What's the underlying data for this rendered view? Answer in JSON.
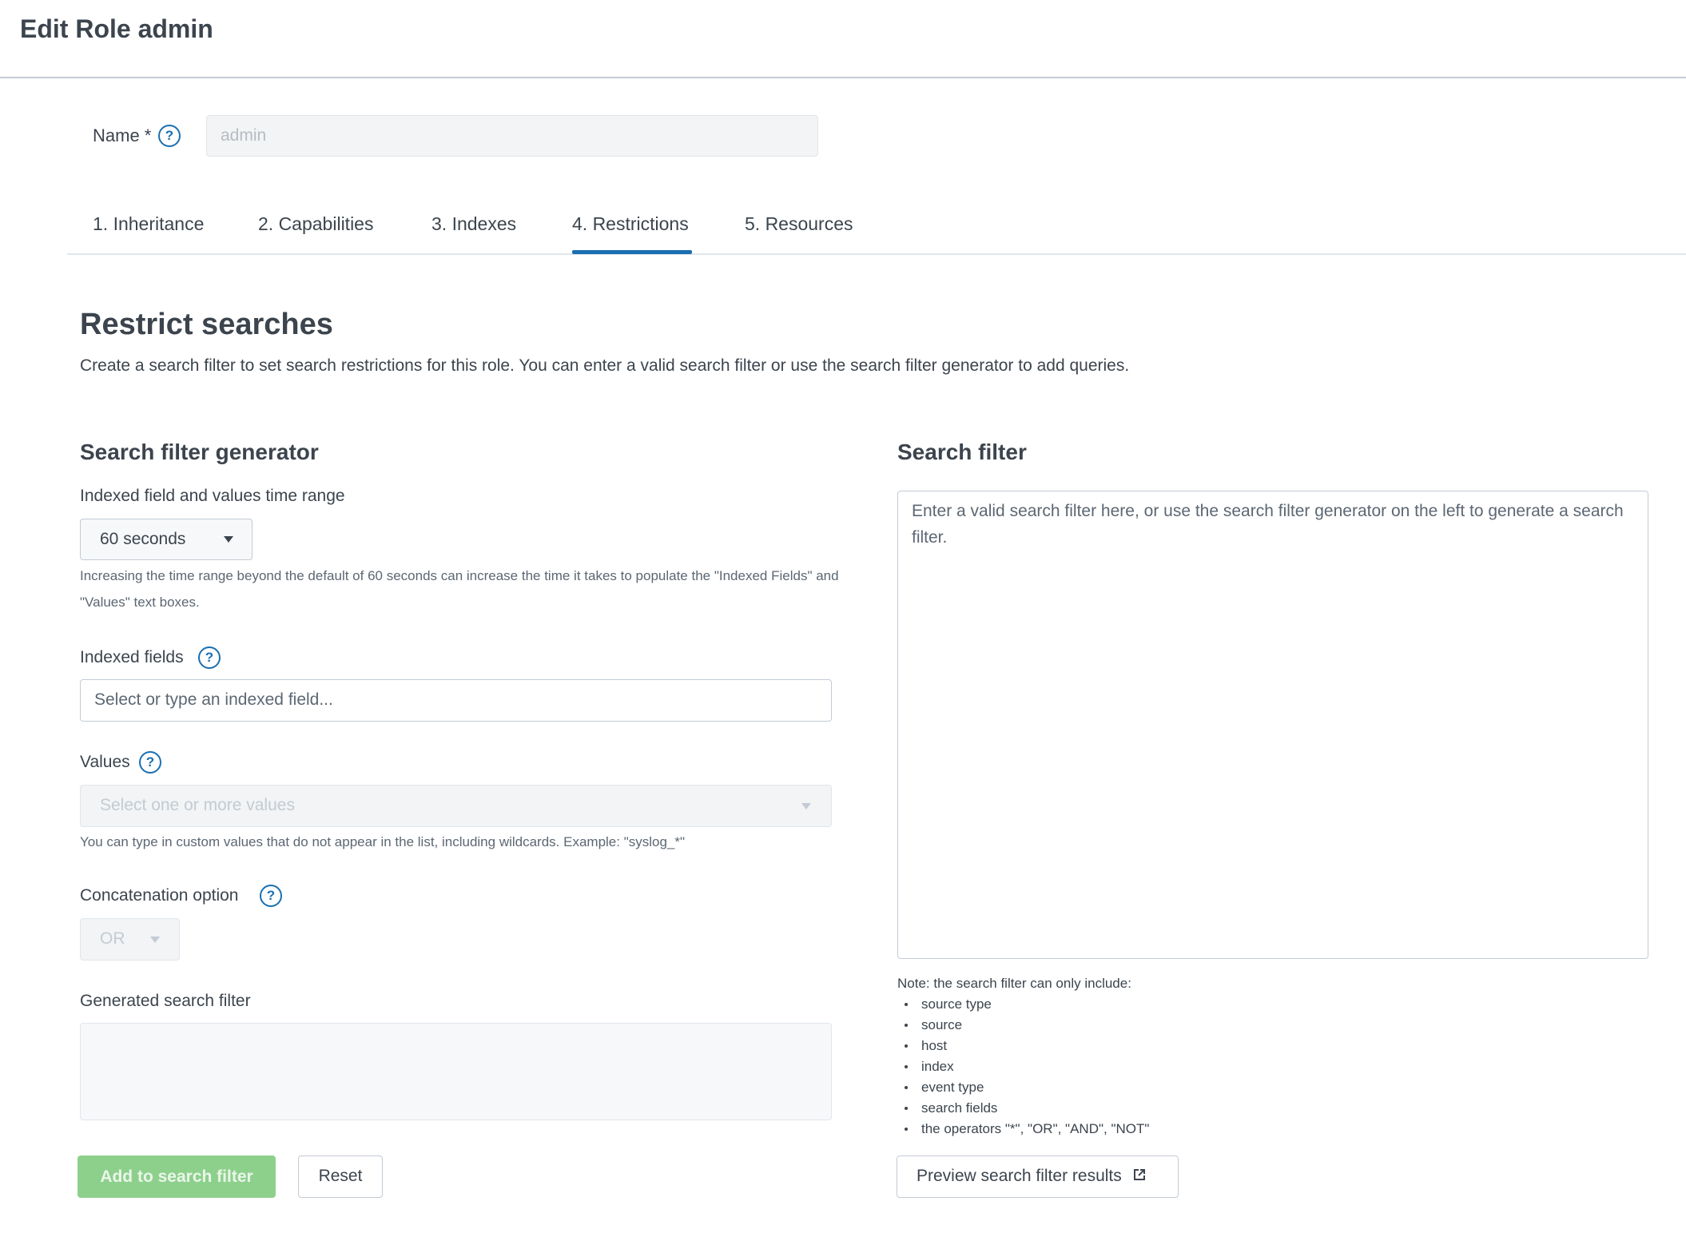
{
  "header": {
    "title": "Edit Role admin"
  },
  "name_field": {
    "label": "Name *",
    "help_glyph": "?",
    "value": "admin"
  },
  "tabs": [
    {
      "label": "1. Inheritance",
      "active": false
    },
    {
      "label": "2. Capabilities",
      "active": false
    },
    {
      "label": "3. Indexes",
      "active": false
    },
    {
      "label": "4. Restrictions",
      "active": true
    },
    {
      "label": "5. Resources",
      "active": false
    }
  ],
  "section": {
    "title": "Restrict searches",
    "description": "Create a search filter to set search restrictions for this role. You can enter a valid search filter or use the search filter generator to add queries."
  },
  "generator": {
    "heading": "Search filter generator",
    "time_range": {
      "label": "Indexed field and values time range",
      "value": "60 seconds",
      "help": "Increasing the time range beyond the default of 60 seconds can increase the time it takes to populate the \"Indexed Fields\" and \"Values\" text boxes."
    },
    "indexed_fields": {
      "label": "Indexed fields",
      "placeholder": "Select or type an indexed field..."
    },
    "values": {
      "label": "Values",
      "placeholder": "Select one or more values",
      "help": "You can type in custom values that do not appear in the list, including wildcards. Example: \"syslog_*\""
    },
    "concatenation": {
      "label": "Concatenation option",
      "value": "OR"
    },
    "generated": {
      "label": "Generated search filter",
      "value": ""
    },
    "add_button": "Add to search filter",
    "reset_button": "Reset"
  },
  "search_filter": {
    "heading": "Search filter",
    "placeholder": "Enter a valid search filter here, or use the search filter generator on the left to generate a search filter.",
    "note_title": "Note: the search filter can only include:",
    "note_items": [
      "source type",
      "source",
      "host",
      "index",
      "event type",
      "search fields",
      "the operators \"*\", \"OR\", \"AND\", \"NOT\""
    ],
    "preview_button": "Preview search filter results"
  },
  "colors": {
    "accent": "#1a6fb0",
    "primary_button_disabled": "#8dd08c",
    "text": "#3c444d",
    "border": "#c3cbd4"
  },
  "icons": {
    "help": "help-circle-icon",
    "caret": "caret-down-icon",
    "external_link": "external-link-icon"
  }
}
